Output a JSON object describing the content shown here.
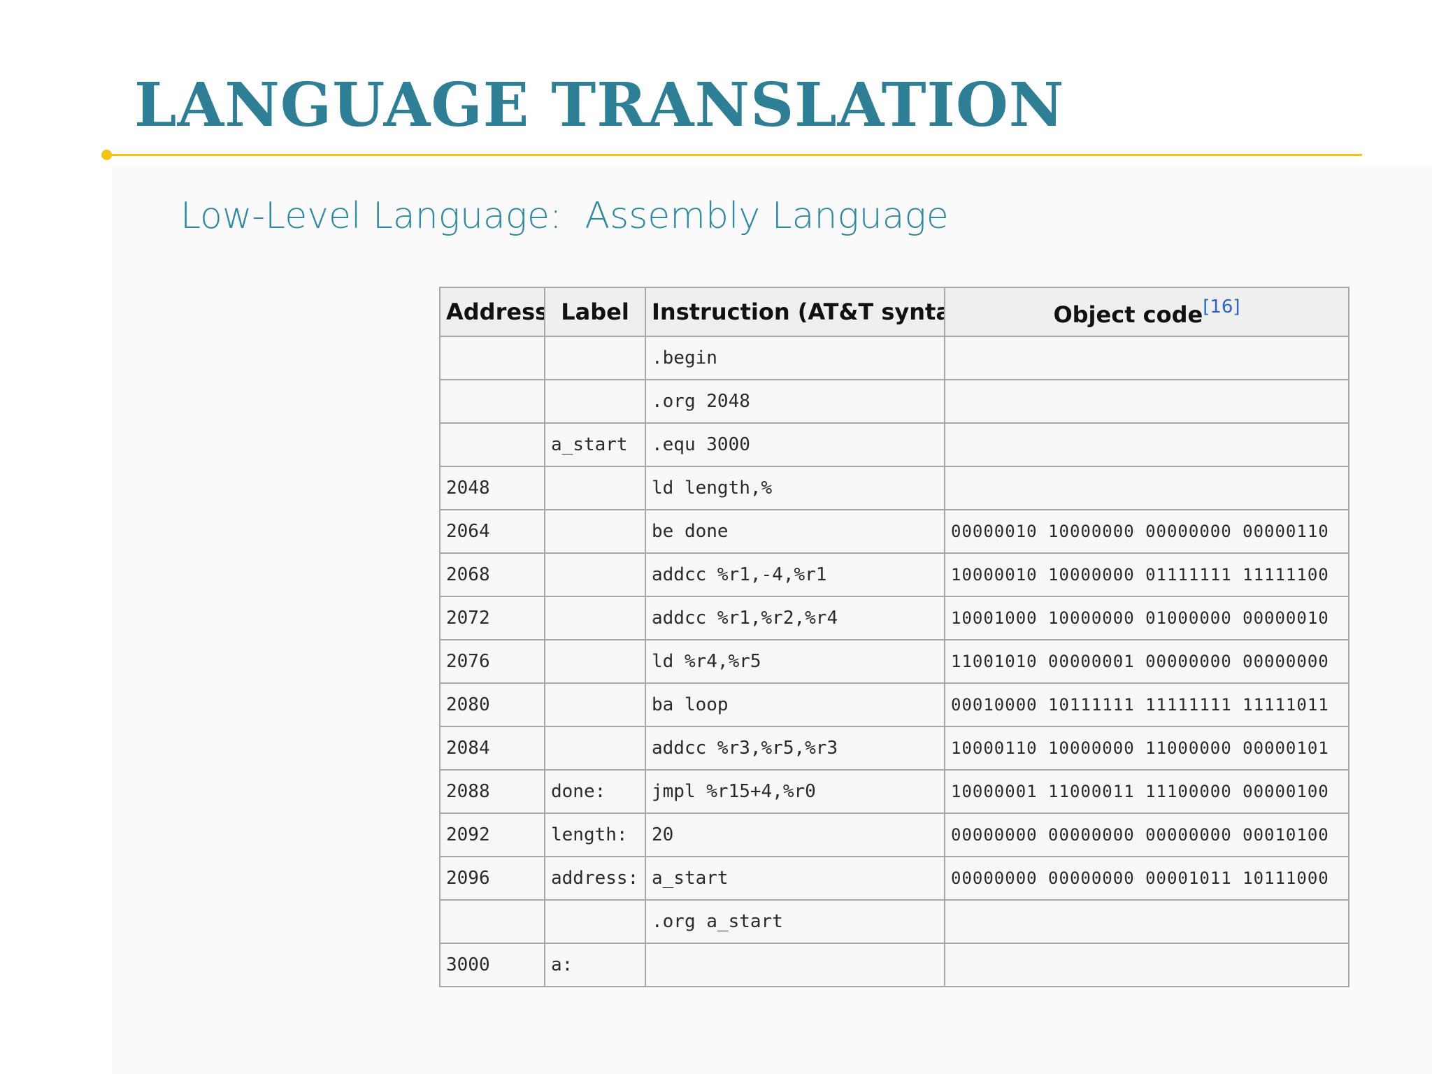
{
  "slide": {
    "title": "LANGUAGE TRANSLATION",
    "subtitle": "Low-Level Language:  Assembly Language"
  },
  "table": {
    "headers": {
      "address": "Address",
      "label": "Label",
      "instruction": "Instruction (AT&T syntax)",
      "object_code": "Object code",
      "object_code_ref": "[16]"
    },
    "rows": [
      {
        "address": "",
        "label": "",
        "instruction": ".begin",
        "object_code": ""
      },
      {
        "address": "",
        "label": "",
        "instruction": ".org 2048",
        "object_code": ""
      },
      {
        "address": "",
        "label": "a_start",
        "instruction": ".equ 3000",
        "object_code": ""
      },
      {
        "address": "2048",
        "label": "",
        "instruction": "ld length,%",
        "object_code": ""
      },
      {
        "address": "2064",
        "label": "",
        "instruction": "be done",
        "object_code": "00000010 10000000 00000000 00000110"
      },
      {
        "address": "2068",
        "label": "",
        "instruction": "addcc %r1,-4,%r1",
        "object_code": "10000010 10000000 01111111 11111100"
      },
      {
        "address": "2072",
        "label": "",
        "instruction": "addcc %r1,%r2,%r4",
        "object_code": "10001000 10000000 01000000 00000010"
      },
      {
        "address": "2076",
        "label": "",
        "instruction": "ld %r4,%r5",
        "object_code": "11001010 00000001 00000000 00000000"
      },
      {
        "address": "2080",
        "label": "",
        "instruction": "ba loop",
        "object_code": "00010000 10111111 11111111 11111011"
      },
      {
        "address": "2084",
        "label": "",
        "instruction": "addcc %r3,%r5,%r3",
        "object_code": "10000110 10000000 11000000 00000101"
      },
      {
        "address": "2088",
        "label": "done:",
        "instruction": "jmpl %r15+4,%r0",
        "object_code": "10000001 11000011 11100000 00000100"
      },
      {
        "address": "2092",
        "label": "length:",
        "instruction": "20",
        "object_code": "00000000 00000000 00000000 00010100"
      },
      {
        "address": "2096",
        "label": "address:",
        "instruction": "a_start",
        "object_code": "00000000 00000000 00001011 10111000"
      },
      {
        "address": "",
        "label": "",
        "instruction": ".org a_start",
        "object_code": ""
      },
      {
        "address": "3000",
        "label": "a:",
        "instruction": "",
        "object_code": ""
      }
    ]
  },
  "colors": {
    "title": "#2e7f96",
    "subtitle": "#2e8aa2",
    "accent_rule": "#f3c316",
    "table_border": "#a7a7a7",
    "reference_link": "#2a64c8"
  }
}
